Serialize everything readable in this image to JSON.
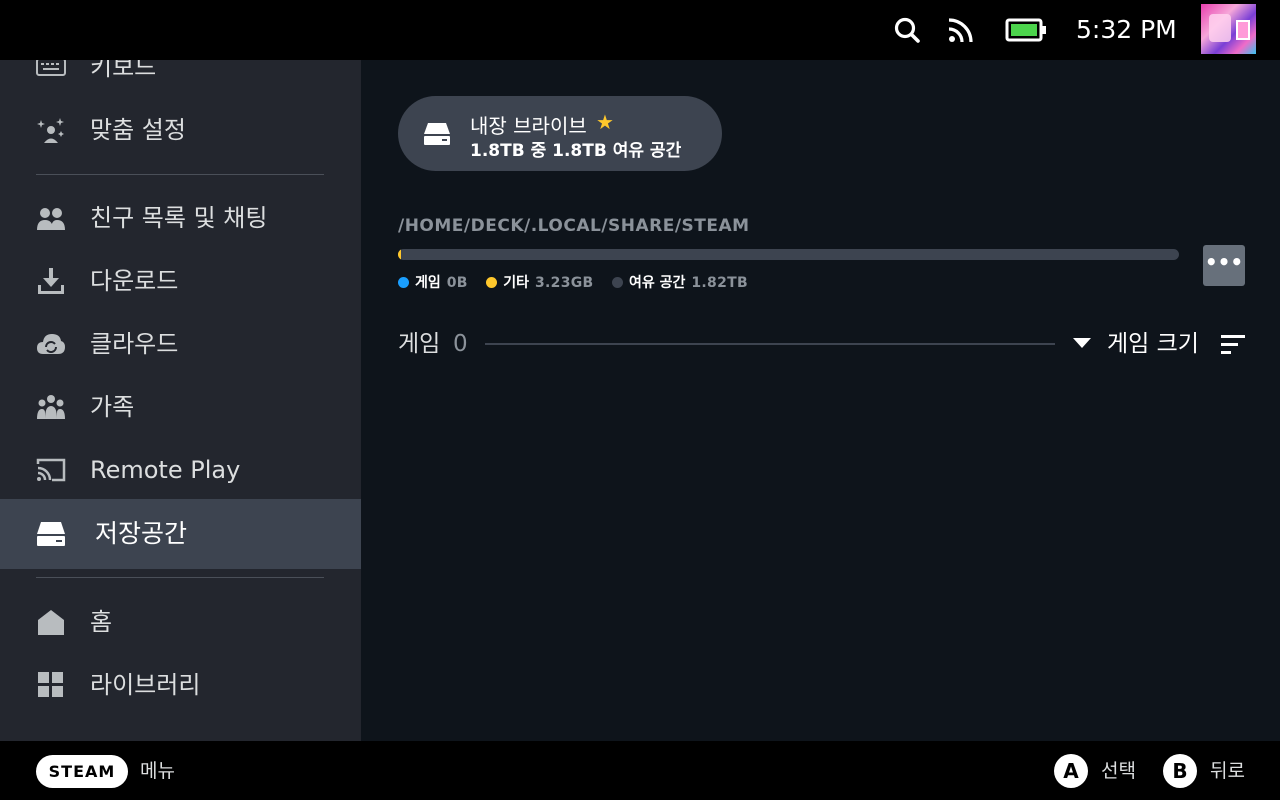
{
  "topbar": {
    "icons": [
      "search-icon",
      "rss-icon",
      "battery-icon"
    ],
    "clock": "5:32 PM",
    "battery_color": "#4cd44c"
  },
  "sidebar": {
    "items": [
      {
        "label": "키보드",
        "icon": "keyboard-icon"
      },
      {
        "label": "맞춤 설정",
        "icon": "sparkle-user-icon"
      },
      {
        "label": "친구 목록 및 채팅",
        "icon": "friends-icon"
      },
      {
        "label": "다운로드",
        "icon": "download-icon"
      },
      {
        "label": "클라우드",
        "icon": "cloud-sync-icon"
      },
      {
        "label": "가족",
        "icon": "family-icon"
      },
      {
        "label": "Remote Play",
        "icon": "cast-icon"
      },
      {
        "label": "저장공간",
        "icon": "drive-icon",
        "active": true
      },
      {
        "label": "홈",
        "icon": "home-icon"
      },
      {
        "label": "라이브러리",
        "icon": "grid-icon"
      }
    ]
  },
  "main": {
    "drive": {
      "name": "내장 브라이브",
      "star": "★",
      "space": "1.8TB 중 1.8TB 여유 공간"
    },
    "path": "/HOME/DECK/.LOCAL/SHARE/STEAM",
    "usage_fraction_other": 0.002,
    "legend": [
      {
        "label": "게임",
        "value": "0B",
        "color": "#1a9fff"
      },
      {
        "label": "기타",
        "value": "3.23GB",
        "color": "#ffc82c"
      },
      {
        "label": "여유 공간",
        "value": "1.82TB",
        "color": "#3d4450"
      }
    ],
    "more_label": "•••",
    "games": {
      "label": "게임",
      "count": "0",
      "sort_label": "게임 크기"
    }
  },
  "bottombar": {
    "steam_label": "STEAM",
    "menu_label": "메뉴",
    "a_button": "A",
    "a_label": "선택",
    "b_button": "B",
    "b_label": "뒤로"
  }
}
